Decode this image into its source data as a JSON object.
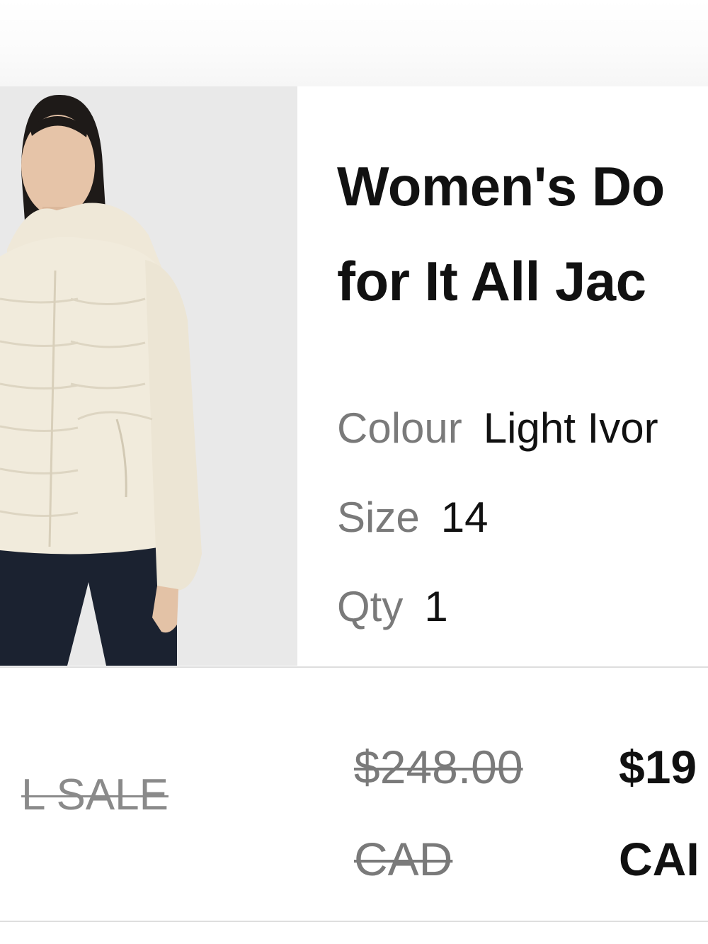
{
  "product": {
    "title": "Women's Do\nfor It All Jac",
    "image_alt": "model-wearing-light-ivory-jacket",
    "colour_label": "Colour",
    "colour_value": "Light Ivor",
    "size_label": "Size",
    "size_value": "14",
    "qty_label": "Qty",
    "qty_value": "1"
  },
  "pricing": {
    "sale_label": "L SALE",
    "old_price_amount": "$248.00",
    "old_price_currency": "CAD",
    "new_price_amount": "$19",
    "new_price_currency": "CAI"
  },
  "colors": {
    "image_background": "#e9e9e9",
    "jacket": "#f1ebdc",
    "leggings": "#1b2230",
    "label_gray": "#7a7a7a",
    "text_dark": "#111111",
    "divider": "#dedede"
  }
}
